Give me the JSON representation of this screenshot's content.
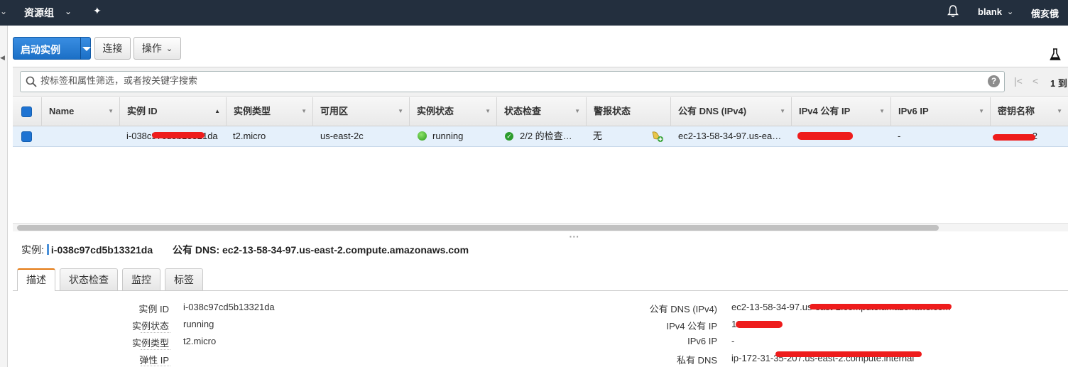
{
  "topnav": {
    "resource_groups": "资源组",
    "username": "blank",
    "region": "俄亥俄"
  },
  "toolbar": {
    "launch_label": "启动实例",
    "connect_label": "连接",
    "actions_label": "操作"
  },
  "filter": {
    "placeholder": "按标签和属性筛选，或者按关键字搜索",
    "help_glyph": "?",
    "pager_text": "1 到"
  },
  "grid": {
    "columns": [
      "Name",
      "实例 ID",
      "实例类型",
      "可用区",
      "实例状态",
      "状态检查",
      "警报状态",
      "公有 DNS (IPv4)",
      "IPv4 公有 IP",
      "IPv6 IP",
      "密钥名称"
    ],
    "row": {
      "name": "",
      "instance_id": "i-038c97cd5b13321da",
      "type": "t2.micro",
      "az": "us-east-2c",
      "state": "running",
      "status_check": "2/2 的检查…",
      "alarm": "无",
      "public_dns": "ec2-13-58-34-97.us-ea…",
      "ipv4": "",
      "ipv6": "-",
      "key": "us-ec2"
    }
  },
  "detail": {
    "instance_label": "实例:",
    "instance_id": "i-038c97cd5b13321da",
    "dns_label": "公有 DNS:",
    "dns_value": "ec2-13-58-34-97.us-east-2.compute.amazonaws.com",
    "tabs": [
      "描述",
      "状态检查",
      "监控",
      "标签"
    ],
    "left": [
      {
        "key": "实例 ID",
        "value": "i-038c97cd5b13321da"
      },
      {
        "key": "实例状态",
        "value": "running"
      },
      {
        "key": "实例类型",
        "value": "t2.micro"
      },
      {
        "key": "弹性 IP",
        "value": ""
      }
    ],
    "right": [
      {
        "key": "公有 DNS (IPv4)",
        "value": "ec2-13-58-34-97.us-east-2.compute.amazonaws.com"
      },
      {
        "key": "IPv4 公有 IP",
        "value": "18."
      },
      {
        "key": "IPv6 IP",
        "value": "-"
      },
      {
        "key": "私有 DNS",
        "value": "ip-172-31-35-207.us-east-2.compute.internal"
      }
    ]
  },
  "colors": {
    "nav_bg": "#232f3e",
    "primary": "#1b6fc6",
    "selected_row": "#e5f0fb",
    "tab_accent": "#e47911",
    "redaction": "#ee1c1c"
  }
}
